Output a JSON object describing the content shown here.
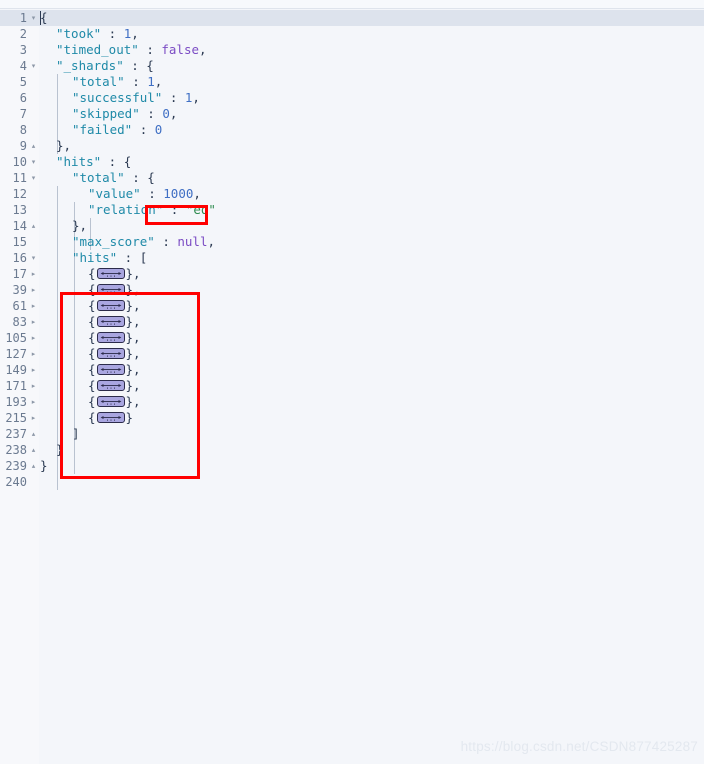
{
  "app": {
    "type": "json-code-editor",
    "language": "JSON",
    "watermark": "https://blog.csdn.net/CSDN877425287"
  },
  "colors": {
    "background": "#f4f6fa",
    "gutter_background": "#f7f8fb",
    "current_line_highlight": "#dde3ed",
    "line_number": "#6b7a90",
    "key": "#1f8aa8",
    "number": "#3f6fc4",
    "keyword": "#7b4cc4",
    "string": "#2e8b4f",
    "punctuation": "#2b3a52",
    "annotation": "#ff0000",
    "fold_widget_fill": "#a9a6e0",
    "fold_widget_border": "#2b2b4a"
  },
  "editor": {
    "lines": [
      {
        "number": "1",
        "fold": "open",
        "indent": 0,
        "current": true,
        "tokens": [
          {
            "t": "{",
            "c": "p"
          }
        ]
      },
      {
        "number": "2",
        "fold": "none",
        "indent": 1,
        "tokens": [
          {
            "t": "\"took\"",
            "c": "k"
          },
          {
            "t": " : ",
            "c": "p"
          },
          {
            "t": "1",
            "c": "num"
          },
          {
            "t": ",",
            "c": "p"
          }
        ]
      },
      {
        "number": "3",
        "fold": "none",
        "indent": 1,
        "tokens": [
          {
            "t": "\"timed_out\"",
            "c": "k"
          },
          {
            "t": " : ",
            "c": "p"
          },
          {
            "t": "false",
            "c": "kw"
          },
          {
            "t": ",",
            "c": "p"
          }
        ]
      },
      {
        "number": "4",
        "fold": "open",
        "indent": 1,
        "tokens": [
          {
            "t": "\"_shards\"",
            "c": "k"
          },
          {
            "t": " : {",
            "c": "p"
          }
        ]
      },
      {
        "number": "5",
        "fold": "none",
        "indent": 2,
        "tokens": [
          {
            "t": "\"total\"",
            "c": "k"
          },
          {
            "t": " : ",
            "c": "p"
          },
          {
            "t": "1",
            "c": "num"
          },
          {
            "t": ",",
            "c": "p"
          }
        ]
      },
      {
        "number": "6",
        "fold": "none",
        "indent": 2,
        "tokens": [
          {
            "t": "\"successful\"",
            "c": "k"
          },
          {
            "t": " : ",
            "c": "p"
          },
          {
            "t": "1",
            "c": "num"
          },
          {
            "t": ",",
            "c": "p"
          }
        ]
      },
      {
        "number": "7",
        "fold": "none",
        "indent": 2,
        "tokens": [
          {
            "t": "\"skipped\"",
            "c": "k"
          },
          {
            "t": " : ",
            "c": "p"
          },
          {
            "t": "0",
            "c": "num"
          },
          {
            "t": ",",
            "c": "p"
          }
        ]
      },
      {
        "number": "8",
        "fold": "none",
        "indent": 2,
        "tokens": [
          {
            "t": "\"failed\"",
            "c": "k"
          },
          {
            "t": " : ",
            "c": "p"
          },
          {
            "t": "0",
            "c": "num"
          }
        ]
      },
      {
        "number": "9",
        "fold": "close",
        "indent": 1,
        "tokens": [
          {
            "t": "},",
            "c": "p"
          }
        ]
      },
      {
        "number": "10",
        "fold": "open",
        "indent": 1,
        "tokens": [
          {
            "t": "\"hits\"",
            "c": "k"
          },
          {
            "t": " : {",
            "c": "p"
          }
        ]
      },
      {
        "number": "11",
        "fold": "open",
        "indent": 2,
        "tokens": [
          {
            "t": "\"total\"",
            "c": "k"
          },
          {
            "t": " : {",
            "c": "p"
          }
        ]
      },
      {
        "number": "12",
        "fold": "none",
        "indent": 3,
        "tokens": [
          {
            "t": "\"value\"",
            "c": "k"
          },
          {
            "t": " : ",
            "c": "p"
          },
          {
            "t": "1000",
            "c": "num"
          },
          {
            "t": ",",
            "c": "p"
          }
        ]
      },
      {
        "number": "13",
        "fold": "none",
        "indent": 3,
        "tokens": [
          {
            "t": "\"relation\"",
            "c": "k"
          },
          {
            "t": " : ",
            "c": "p"
          },
          {
            "t": "\"eq\"",
            "c": "str"
          }
        ]
      },
      {
        "number": "14",
        "fold": "close",
        "indent": 2,
        "tokens": [
          {
            "t": "},",
            "c": "p"
          }
        ]
      },
      {
        "number": "15",
        "fold": "none",
        "indent": 2,
        "tokens": [
          {
            "t": "\"max_score\"",
            "c": "k"
          },
          {
            "t": " : ",
            "c": "p"
          },
          {
            "t": "null",
            "c": "kw"
          },
          {
            "t": ",",
            "c": "p"
          }
        ]
      },
      {
        "number": "16",
        "fold": "open",
        "indent": 2,
        "tokens": [
          {
            "t": "\"hits\"",
            "c": "k"
          },
          {
            "t": " : [",
            "c": "p"
          }
        ]
      },
      {
        "number": "17",
        "fold": "collapsed",
        "indent": 3,
        "tokens": [
          {
            "t": "{",
            "c": "p"
          },
          {
            "t": "FOLD"
          },
          {
            "t": "},",
            "c": "p"
          }
        ]
      },
      {
        "number": "39",
        "fold": "collapsed",
        "indent": 3,
        "tokens": [
          {
            "t": "{",
            "c": "p"
          },
          {
            "t": "FOLD"
          },
          {
            "t": "},",
            "c": "p"
          }
        ]
      },
      {
        "number": "61",
        "fold": "collapsed",
        "indent": 3,
        "tokens": [
          {
            "t": "{",
            "c": "p"
          },
          {
            "t": "FOLD"
          },
          {
            "t": "},",
            "c": "p"
          }
        ]
      },
      {
        "number": "83",
        "fold": "collapsed",
        "indent": 3,
        "tokens": [
          {
            "t": "{",
            "c": "p"
          },
          {
            "t": "FOLD"
          },
          {
            "t": "},",
            "c": "p"
          }
        ]
      },
      {
        "number": "105",
        "fold": "collapsed",
        "indent": 3,
        "tokens": [
          {
            "t": "{",
            "c": "p"
          },
          {
            "t": "FOLD"
          },
          {
            "t": "},",
            "c": "p"
          }
        ]
      },
      {
        "number": "127",
        "fold": "collapsed",
        "indent": 3,
        "tokens": [
          {
            "t": "{",
            "c": "p"
          },
          {
            "t": "FOLD"
          },
          {
            "t": "},",
            "c": "p"
          }
        ]
      },
      {
        "number": "149",
        "fold": "collapsed",
        "indent": 3,
        "tokens": [
          {
            "t": "{",
            "c": "p"
          },
          {
            "t": "FOLD"
          },
          {
            "t": "},",
            "c": "p"
          }
        ]
      },
      {
        "number": "171",
        "fold": "collapsed",
        "indent": 3,
        "tokens": [
          {
            "t": "{",
            "c": "p"
          },
          {
            "t": "FOLD"
          },
          {
            "t": "},",
            "c": "p"
          }
        ]
      },
      {
        "number": "193",
        "fold": "collapsed",
        "indent": 3,
        "tokens": [
          {
            "t": "{",
            "c": "p"
          },
          {
            "t": "FOLD"
          },
          {
            "t": "},",
            "c": "p"
          }
        ]
      },
      {
        "number": "215",
        "fold": "collapsed",
        "indent": 3,
        "tokens": [
          {
            "t": "{",
            "c": "p"
          },
          {
            "t": "FOLD"
          },
          {
            "t": "}",
            "c": "p"
          }
        ]
      },
      {
        "number": "237",
        "fold": "close",
        "indent": 2,
        "tokens": [
          {
            "t": "]",
            "c": "p"
          }
        ]
      },
      {
        "number": "238",
        "fold": "close",
        "indent": 1,
        "tokens": [
          {
            "t": "}",
            "c": "p"
          }
        ]
      },
      {
        "number": "239",
        "fold": "close",
        "indent": 0,
        "tokens": [
          {
            "t": "}",
            "c": "p"
          }
        ]
      },
      {
        "number": "240",
        "fold": "none",
        "indent": 0,
        "tokens": []
      }
    ],
    "fold_glyphs": {
      "open": "▾",
      "close": "▴",
      "collapsed": "▸",
      "none": ""
    }
  },
  "annotations": [
    {
      "name": "annot-value",
      "label": "highlight around value 1000"
    },
    {
      "name": "annot-hits",
      "label": "highlight around collapsed hits array"
    }
  ]
}
